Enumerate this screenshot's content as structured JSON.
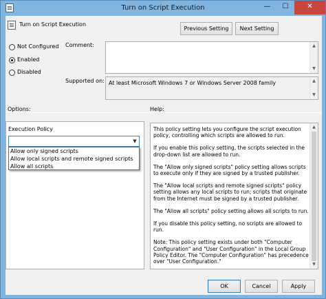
{
  "window": {
    "title": "Turn on Script Execution",
    "controls": {
      "minimize": "—",
      "maximize": "☐",
      "close": "✕"
    }
  },
  "header": {
    "policy_name": "Turn on Script Execution",
    "icon": "policy-document-icon",
    "previous_button": "Previous Setting",
    "next_button": "Next Setting"
  },
  "state": {
    "options": [
      {
        "label": "Not Configured",
        "checked": false
      },
      {
        "label": "Enabled",
        "checked": true
      },
      {
        "label": "Disabled",
        "checked": false
      }
    ]
  },
  "comment": {
    "label": "Comment:",
    "value": ""
  },
  "supported_on": {
    "label": "Supported on:",
    "value": "At least Microsoft Windows 7 or Windows Server 2008 family"
  },
  "options_panel": {
    "header": "Options:",
    "execution_policy_label": "Execution Policy",
    "selected_value": "",
    "dropdown_items": [
      "Allow only signed scripts",
      "Allow local scripts and remote signed scripts",
      "Allow all scripts"
    ]
  },
  "help_panel": {
    "header": "Help:",
    "paragraphs": [
      "This policy setting lets you configure the script execution policy, controlling which scripts are allowed to run.",
      "If you enable this policy setting, the scripts selected in the drop-down list are allowed to run.",
      "The \"Allow only signed scripts\" policy setting allows scripts to execute only if they are signed by a trusted publisher.",
      "The \"Allow local scripts and remote signed scripts\" policy setting allows any local scripts to run; scripts that originate from the Internet must be signed by a trusted publisher.",
      "The \"Allow all scripts\" policy setting allows all scripts to run.",
      "If you disable this policy setting, no scripts are allowed to run.",
      "Note: This policy setting exists under both \"Computer Configuration\" and \"User Configuration\" in the Local Group Policy Editor. The \"Computer Configuration\" has precedence over \"User Configuration.\""
    ]
  },
  "footer": {
    "ok_button": "OK",
    "cancel_button": "Cancel",
    "apply_button": "Apply"
  },
  "colors": {
    "title_bar": "#7fb5de",
    "close_button": "#c7463d",
    "dialog_background": "#f0f0f0",
    "focus_border": "#3c7fb1"
  }
}
